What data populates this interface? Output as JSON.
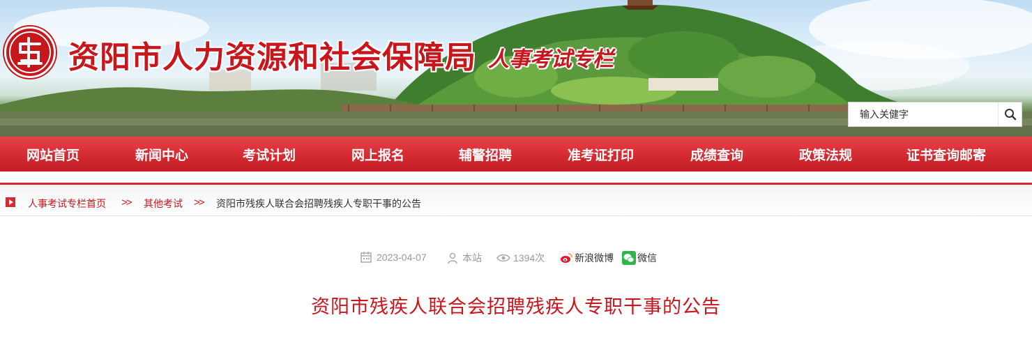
{
  "header": {
    "site_title": "资阳市人力资源和社会保障局",
    "subtitle": "人事考试专栏",
    "search_placeholder": "输入关健字"
  },
  "nav": {
    "items": [
      {
        "label": "网站首页"
      },
      {
        "label": "新闻中心"
      },
      {
        "label": "考试计划"
      },
      {
        "label": "网上报名"
      },
      {
        "label": "辅警招聘"
      },
      {
        "label": "准考证打印"
      },
      {
        "label": "成绩查询"
      },
      {
        "label": "政策法规"
      },
      {
        "label": "证书查询邮寄"
      }
    ]
  },
  "breadcrumb": {
    "items": [
      {
        "label": "人事考试专栏首页"
      },
      {
        "label": "其他考试"
      },
      {
        "label": "资阳市残疾人联合会招聘残疾人专职干事的公告"
      }
    ],
    "separator": ">>"
  },
  "article": {
    "date": "2023-04-07",
    "source": "本站",
    "views": "1394次",
    "share_weibo": "新浪微博",
    "share_wechat": "微信",
    "title": "资阳市残疾人联合会招聘残疾人专职干事的公告"
  },
  "colors": {
    "accent_red": "#c8161d",
    "nav_red": "#d42a31",
    "meta_gray": "#999999"
  },
  "icons": [
    "seal-logo-icon",
    "search-icon",
    "breadcrumb-arrow-icon",
    "calendar-icon",
    "user-icon",
    "eye-icon",
    "weibo-icon",
    "wechat-icon"
  ]
}
